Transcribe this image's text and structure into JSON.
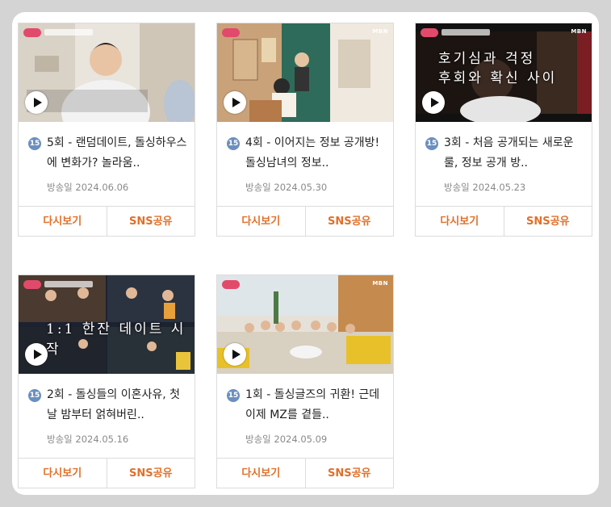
{
  "episodes": [
    {
      "title": "5회 - 랜덤데이트, 돌싱하우스에 변화가? 놀라움..",
      "date": "방송일 2024.06.06",
      "rating": "15",
      "replay": "다시보기",
      "share": "SNS공유",
      "thumb_caption": ""
    },
    {
      "title": "4회 - 이어지는 정보 공개방! 돌싱남녀의 정보..",
      "date": "방송일 2024.05.30",
      "rating": "15",
      "replay": "다시보기",
      "share": "SNS공유",
      "thumb_caption": ""
    },
    {
      "title": "3회 - 처음 공개되는 새로운 룰, 정보 공개 방..",
      "date": "방송일 2024.05.23",
      "rating": "15",
      "replay": "다시보기",
      "share": "SNS공유",
      "thumb_caption": "호기심과 걱정\n후회와 확신 사이"
    },
    {
      "title": "2회 - 돌싱들의 이혼사유, 첫날 밤부터 얽혀버린..",
      "date": "방송일 2024.05.16",
      "rating": "15",
      "replay": "다시보기",
      "share": "SNS공유",
      "thumb_caption": "1:1 한잔 데이트 시작"
    },
    {
      "title": "1회 - 돌싱글즈의 귀환! 근데 이제 MZ를 곁들..",
      "date": "방송일 2024.05.09",
      "rating": "15",
      "replay": "다시보기",
      "share": "SNS공유",
      "thumb_caption": ""
    }
  ],
  "channel_logo": "MBN",
  "colors": {
    "accent": "#e0702a",
    "rating": "#6b8fbf",
    "background": "#d4d4d4"
  }
}
